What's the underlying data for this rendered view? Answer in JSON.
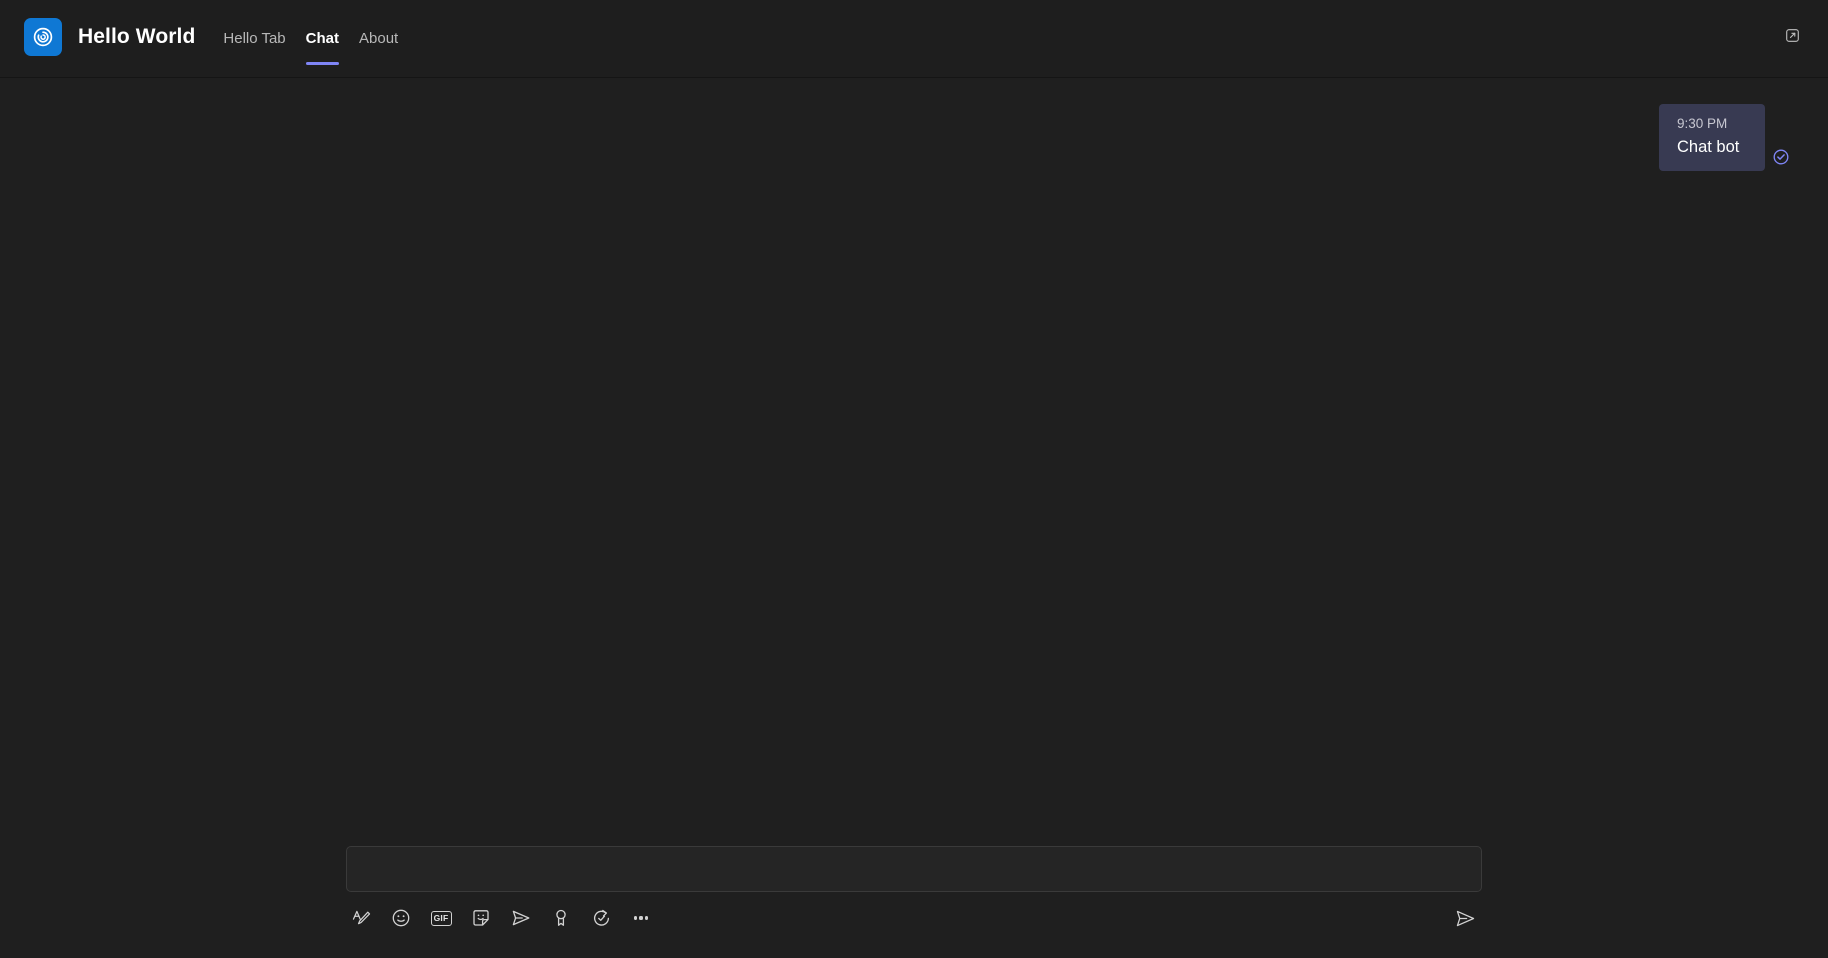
{
  "header": {
    "app_icon_name": "hello-world-app-icon",
    "app_icon_color": "#0f78d4",
    "title": "Hello World",
    "tabs": [
      {
        "label": "Hello Tab",
        "active": false
      },
      {
        "label": "Chat",
        "active": true
      },
      {
        "label": "About",
        "active": false
      }
    ],
    "active_tab_accent": "#7f85f5",
    "popout_label": "Open in new window"
  },
  "conversation": {
    "messages": [
      {
        "time": "9:30 PM",
        "text": "Chat bot",
        "align": "right",
        "bubble_color": "#383a52",
        "status_icon": "sent-check-icon",
        "status_color": "#7f85f5"
      }
    ]
  },
  "composer": {
    "input_value": "",
    "input_placeholder": "",
    "tools": [
      {
        "name": "format-text-icon",
        "label": "Format"
      },
      {
        "name": "emoji-icon",
        "label": "Emoji"
      },
      {
        "name": "gif-icon",
        "label": "GIF"
      },
      {
        "name": "sticker-icon",
        "label": "Sticker"
      },
      {
        "name": "stream-icon",
        "label": "Stream"
      },
      {
        "name": "praise-icon",
        "label": "Praise"
      },
      {
        "name": "loop-icon",
        "label": "Loop components"
      },
      {
        "name": "more-options-icon",
        "label": "More options"
      }
    ],
    "gif_text": "GIF",
    "send_label": "Send"
  },
  "colors": {
    "background": "#1f1f1f",
    "header_background": "#1e1e1e",
    "accent_purple": "#7f85f5",
    "accent_blue": "#0f78d4",
    "text_primary": "#ffffff",
    "text_secondary": "#b8b8b8"
  }
}
